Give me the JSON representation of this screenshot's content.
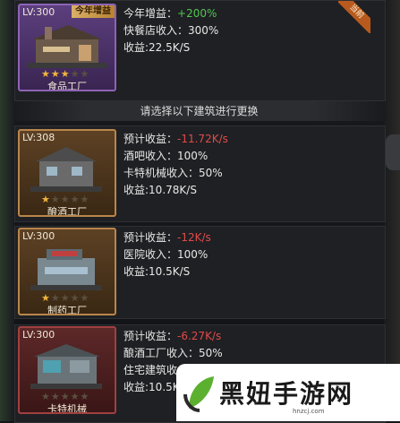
{
  "current": {
    "level": "LV:300",
    "tag": "今年增益",
    "name": "食品工厂",
    "stars_on": 3,
    "stars_total": 5,
    "badge": "当前",
    "lines": [
      {
        "label": "今年增益：",
        "value": "+200%"
      },
      {
        "label": "快餐店收入：",
        "value": "300%"
      },
      {
        "label": "收益:",
        "value": "22.5K/S"
      }
    ]
  },
  "divider_text": "请选择以下建筑进行更换",
  "candidates": [
    {
      "level": "LV:308",
      "name": "酿酒工厂",
      "stars_on": 1,
      "stars_total": 5,
      "lines": [
        {
          "label": "预计收益：",
          "value": "-11.72K/s"
        },
        {
          "label": "酒吧收入：",
          "value": "100%"
        },
        {
          "label": "卡特机械收入：",
          "value": "50%"
        },
        {
          "label": "收益:",
          "value": "10.78K/S"
        }
      ]
    },
    {
      "level": "LV:300",
      "name": "制药工厂",
      "stars_on": 1,
      "stars_total": 5,
      "lines": [
        {
          "label": "预计收益：",
          "value": "-12K/s"
        },
        {
          "label": "医院收入：",
          "value": "100%"
        },
        {
          "label": "收益:",
          "value": "10.5K/S"
        }
      ]
    },
    {
      "level": "LV:300",
      "name": "卡特机械",
      "stars_on": 0,
      "stars_total": 5,
      "lines": [
        {
          "label": "预计收益：",
          "value": "-6.27K/s"
        },
        {
          "label": "酿酒工厂收入：",
          "value": "50%"
        },
        {
          "label": "住宅建筑收",
          "value": ""
        },
        {
          "label": "收益:",
          "value": "10.5K"
        }
      ]
    }
  ],
  "watermark": {
    "text": "黑妞手游网",
    "url": "hnzcj.com"
  },
  "colors": {
    "negative": "#e04a4a",
    "positive": "#52c652",
    "card_border": "#b9864a"
  }
}
